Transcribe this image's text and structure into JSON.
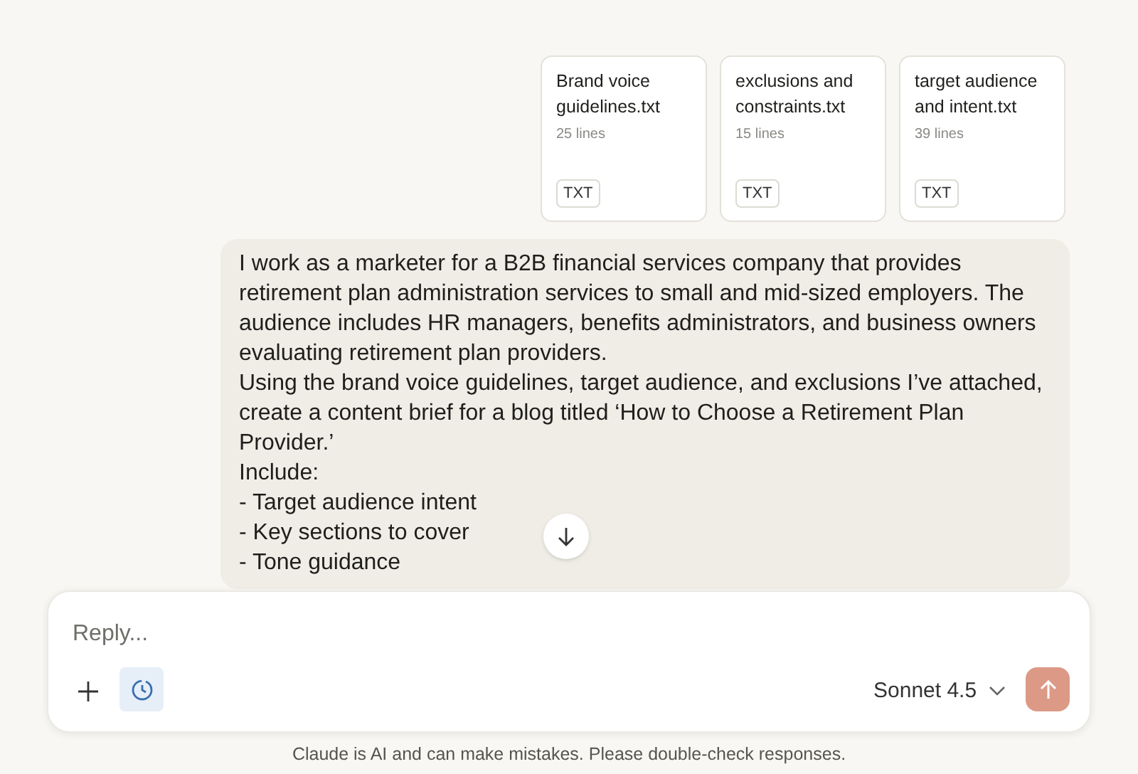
{
  "attachments": [
    {
      "name": "Brand voice guidelines.txt",
      "lines": "25 lines",
      "type": "TXT"
    },
    {
      "name": "exclusions and constraints.txt",
      "lines": "15 lines",
      "type": "TXT"
    },
    {
      "name": "target audience and intent.txt",
      "lines": "39 lines",
      "type": "TXT"
    }
  ],
  "message": {
    "paragraphs": [
      "I work as a marketer for a B2B financial services company that provides retirement plan administration services to small and mid-sized employers. The audience includes HR managers, benefits administrators, and business owners evaluating retirement plan providers.",
      "Using the brand voice guidelines, target audience, and exclusions I’ve attached, create a content brief for a blog titled ‘How to Choose a Retirement Plan Provider.’",
      "Include:",
      "- Target audience intent",
      "- Key sections to cover",
      "- Tone guidance"
    ]
  },
  "composer": {
    "placeholder": "Reply...",
    "history_selected": true,
    "model": "Sonnet 4.5"
  },
  "disclaimer": "Claude is AI and can make mistakes. Please double-check responses."
}
